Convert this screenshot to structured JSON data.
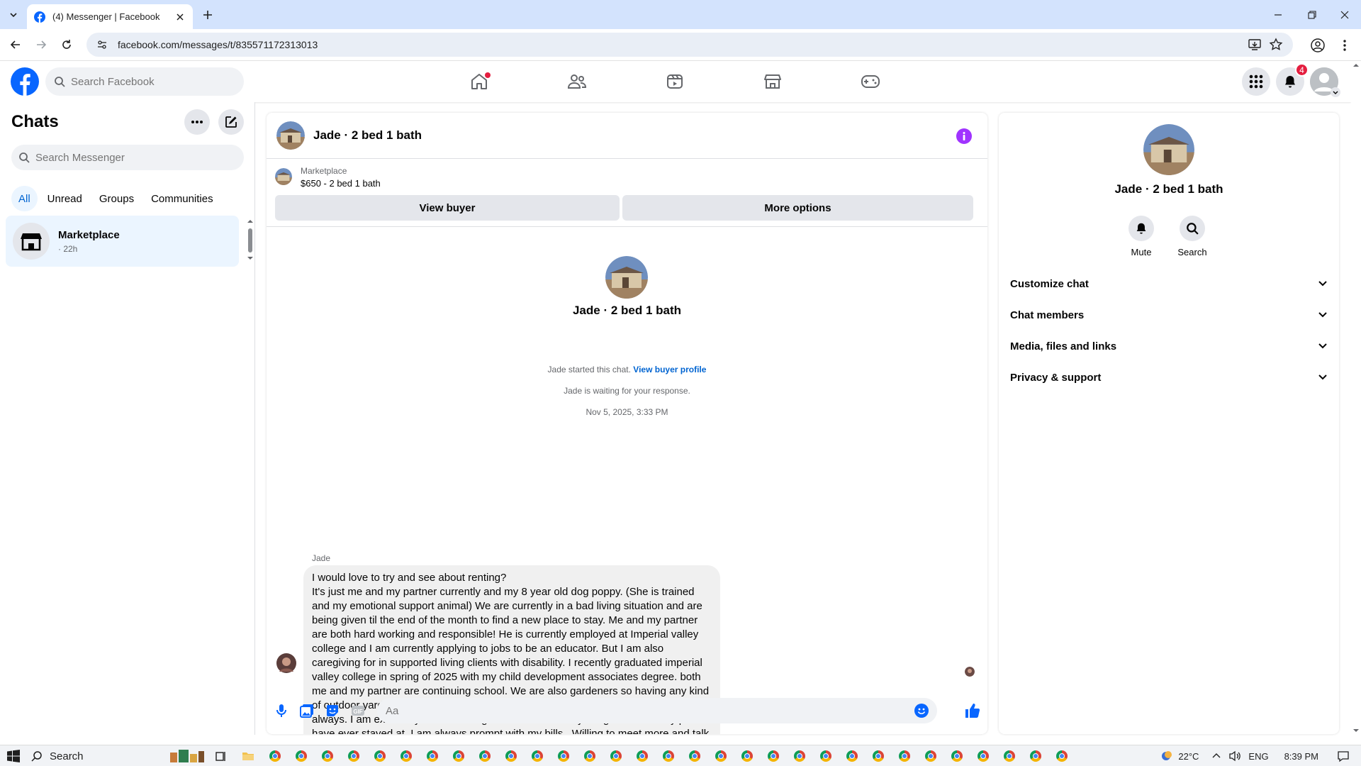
{
  "browser": {
    "tab_title": "(4) Messenger | Facebook",
    "url": "facebook.com/messages/t/835571172313013"
  },
  "fb_header": {
    "search_placeholder": "Search Facebook",
    "notifications_count": "4"
  },
  "chats": {
    "title": "Chats",
    "search_placeholder": "Search Messenger",
    "filters": [
      "All",
      "Unread",
      "Groups",
      "Communities"
    ],
    "items": [
      {
        "name": "Marketplace",
        "time": "· 22h"
      }
    ]
  },
  "conversation": {
    "name": "Jade · 2 bed 1 bath",
    "listing": {
      "source": "Marketplace",
      "title": "$650 - 2 bed 1 bath",
      "view_buyer": "View buyer",
      "more_options": "More options"
    },
    "intro_name": "Jade · 2 bed 1 bath",
    "started_text": "Jade started this chat.",
    "view_profile_link": "View buyer profile",
    "waiting_text": "Jade is waiting for your response.",
    "date": "Nov 5, 2025, 3:33 PM",
    "sender": "Jade",
    "message": "I would love to try and see about renting?\nIt's just me and my partner currently and my 8 year old dog poppy. (She is trained and my emotional support animal) We are currently in a bad living situation and are being given til the end of the month to find a new place to stay. Me and my partner are both hard working and responsible! He is currently employed at Imperial valley college and I am currently applying to jobs to be an educator. But I am also caregiving for in supported living clients with disability. I recently graduated imperial valley college in spring of 2025 with my child development associates degree. both me and my partner are continuing school. We are also gardeners so having any kind of outdoor yard space I just want u to know it will be maintained and cared for always. I am extremely clean and organized with all of my things and at every place I have ever stayed at. I am always prompt with my bills . Willing to meet more and talk more in person or on the phone. Look forward to speaking more with u. You can call me at (442) 354-4617, look forward to hearing from you. Thank you and have a nice day!",
    "composer_placeholder": "Aa"
  },
  "details": {
    "name": "Jade · 2 bed 1 bath",
    "actions": [
      {
        "label": "Mute",
        "icon": "bell-icon"
      },
      {
        "label": "Search",
        "icon": "search-icon"
      }
    ],
    "sections": [
      "Customize chat",
      "Chat members",
      "Media, files and links",
      "Privacy & support"
    ]
  },
  "taskbar": {
    "search_label": "Search",
    "weather": "22°C",
    "language": "ENG",
    "time": "8:39 PM"
  },
  "colors": {
    "fb_blue": "#0866ff",
    "link_blue": "#0064d1",
    "selected_bg": "#ebf5ff",
    "info_purple": "#a033ff",
    "badge_red": "#e41e3f"
  }
}
